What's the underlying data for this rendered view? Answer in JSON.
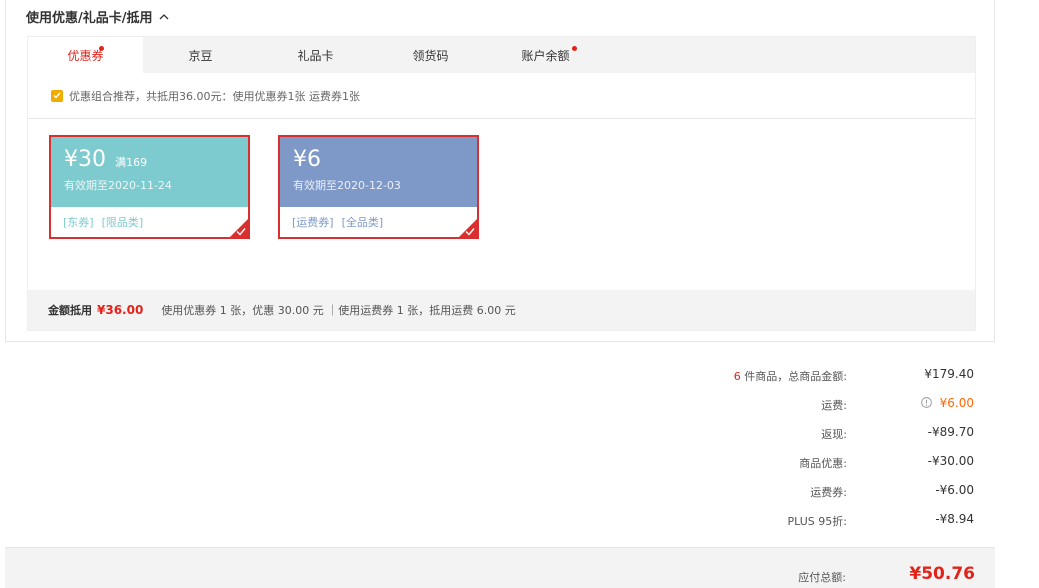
{
  "section": {
    "title": "使用优惠/礼品卡/抵用"
  },
  "tabs": [
    {
      "label": "优惠券",
      "active": true,
      "dot": true
    },
    {
      "label": "京豆",
      "active": false,
      "dot": false
    },
    {
      "label": "礼品卡",
      "active": false,
      "dot": false
    },
    {
      "label": "领货码",
      "active": false,
      "dot": false
    },
    {
      "label": "账户余额",
      "active": false,
      "dot": true
    }
  ],
  "combo": {
    "text": "优惠组合推荐，共抵用36.00元：使用优惠券1张 运费券1张",
    "checked": true
  },
  "coupons": [
    {
      "amount": "¥30",
      "condition": "满169",
      "valid": "有效期至2020-11-24",
      "tags": [
        "[东券]",
        "[限品类]"
      ],
      "color": "#7ecbcf",
      "tag_color": "#7ecbcf",
      "selected": true
    },
    {
      "amount": "¥6",
      "condition": "",
      "valid": "有效期至2020-12-03",
      "tags": [
        "[运费券]",
        "[全品类]"
      ],
      "color": "#7e99c8",
      "tag_color": "#7e99c8",
      "selected": true
    }
  ],
  "summary": {
    "label": "金额抵用",
    "value": "¥36.00",
    "detail": "使用优惠券 1 张，优惠 30.00 元 ｜使用运费券 1 张，抵用运费 6.00 元"
  },
  "totals": {
    "count": "6",
    "count_suffix": " 件商品，总商品金额:",
    "goods_total": "¥179.40",
    "shipping_label": "运费:",
    "shipping_value": "¥6.00",
    "cashback_label": "返现:",
    "cashback_value": "-¥89.70",
    "discount_label": "商品优惠:",
    "discount_value": "-¥30.00",
    "freight_coupon_label": "运费券:",
    "freight_coupon_value": "-¥6.00",
    "plus_label": "PLUS 95折:",
    "plus_value": "-¥8.94"
  },
  "payable": {
    "label": "应付总额:",
    "value": "¥50.76"
  },
  "colors": {
    "accent": "#e2231a",
    "orange": "#ff6600",
    "check": "#f0ad00"
  }
}
